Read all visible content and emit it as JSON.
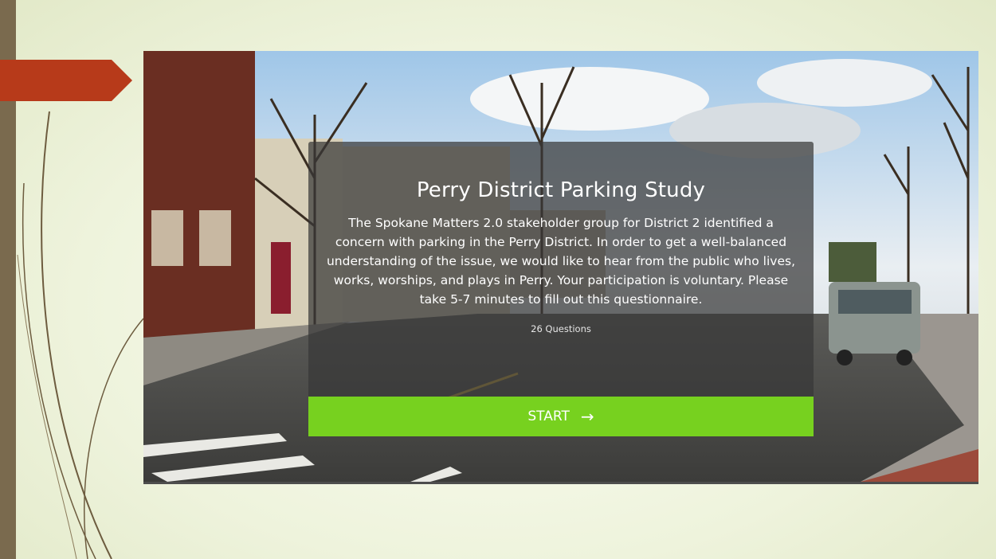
{
  "survey": {
    "title": "Perry District Parking Study",
    "description": "The Spokane Matters 2.0 stakeholder group for District 2 identified a concern with parking in the Perry District. In order to get a well-balanced understanding of the issue, we would like to hear from the public who lives, works, worships, and plays in Perry. Your participation is voluntary. Please take 5-7 minutes to fill out this questionnaire.",
    "question_count": "26 Questions",
    "start_label": "START",
    "start_icon": "arrow-right-icon",
    "start_arrow_glyph": "→"
  },
  "colors": {
    "accent": "#77d11f",
    "slide_marker": "#b73a1a",
    "left_bar": "#7a6a4e"
  }
}
